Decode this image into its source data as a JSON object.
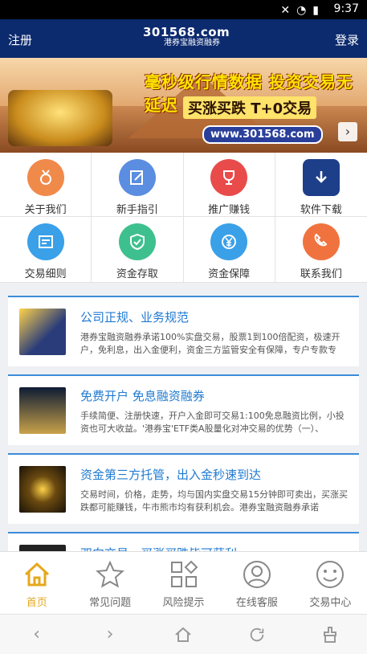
{
  "status_bar": {
    "time": "9:37"
  },
  "header": {
    "register": "注册",
    "login": "登录",
    "logo_top": "301568.com",
    "logo_bottom": "港券宝融资融券"
  },
  "banner": {
    "headline1": "毫秒级行情数据 投资交易无延迟",
    "headline2": "买涨买跌  T+0交易",
    "url": "www.301568.com",
    "next_icon": "chevron-right-icon"
  },
  "grid": [
    {
      "label": "关于我们",
      "color": "#f08a4b",
      "icon": "medal-icon"
    },
    {
      "label": "新手指引",
      "color": "#5b8de0",
      "icon": "edit-icon"
    },
    {
      "label": "推广赚钱",
      "color": "#e94b4b",
      "icon": "trophy-icon"
    },
    {
      "label": "软件下载",
      "color": "#1d3f8a",
      "icon": "download-icon"
    },
    {
      "label": "交易细则",
      "color": "#3aa0e8",
      "icon": "document-icon"
    },
    {
      "label": "资金存取",
      "color": "#3ec08e",
      "icon": "shield-check-icon"
    },
    {
      "label": "资金保障",
      "color": "#3aa0e8",
      "icon": "yen-icon"
    },
    {
      "label": "联系我们",
      "color": "#f0733f",
      "icon": "phone-icon"
    }
  ],
  "cards": [
    {
      "title": "公司正规、业务规范",
      "desc": "港券宝融资融券承诺100%实盘交易，股票1到100倍配资，极速开户，免利息，出入金便利，资金三方监管安全有保障，专户专款专",
      "thumb": "#2a3d7a"
    },
    {
      "title": "免费开户 免息融资融券",
      "desc": "手续简便、注册快速，开户入金即可交易1:100免息融资比例，小投资也可大收益。'港券宝'ETF类A股量化对冲交易的优势（一）、",
      "thumb": "#1b2c4a"
    },
    {
      "title": "资金第三方托管，出入金秒速到达",
      "desc": "交易时间，价格，走势，均与国内实盘交易15分钟即可卖出，买涨买跌都可能赚钱，牛市熊市均有获利机会。港券宝融资融券承诺",
      "thumb": "#3a2a10"
    },
    {
      "title": "双向交易，买涨买跌皆可获利",
      "desc": "",
      "thumb": "#222"
    }
  ],
  "tabs": [
    {
      "label": "首页",
      "icon": "home-icon",
      "active": true
    },
    {
      "label": "常见问题",
      "icon": "star-icon",
      "active": false
    },
    {
      "label": "风险提示",
      "icon": "grid-icon",
      "active": false
    },
    {
      "label": "在线客服",
      "icon": "user-icon",
      "active": false
    },
    {
      "label": "交易中心",
      "icon": "smile-icon",
      "active": false
    }
  ],
  "nav": [
    "back-icon",
    "forward-icon",
    "home-icon",
    "refresh-icon",
    "clean-icon"
  ]
}
